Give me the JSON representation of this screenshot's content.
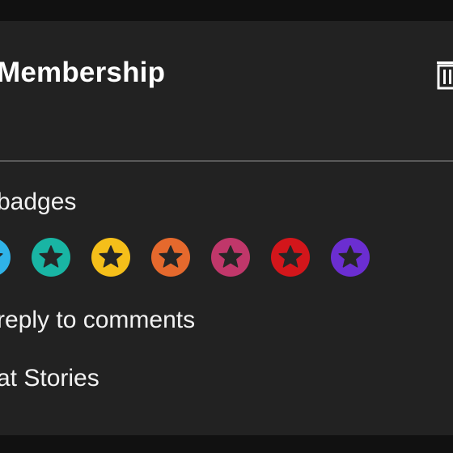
{
  "header": {
    "title": "Membership"
  },
  "perks": [
    {
      "label": "badges"
    },
    {
      "label": "reply to comments"
    },
    {
      "label": "at Stories"
    }
  ],
  "badges": [
    {
      "name": "badge-sky",
      "color": "#2fb3e8"
    },
    {
      "name": "badge-teal",
      "color": "#19b5a4"
    },
    {
      "name": "badge-yellow",
      "color": "#f5bf1a"
    },
    {
      "name": "badge-orange",
      "color": "#e5692d"
    },
    {
      "name": "badge-pink",
      "color": "#c0376a"
    },
    {
      "name": "badge-red",
      "color": "#d3161b"
    },
    {
      "name": "badge-purple",
      "color": "#6b2ed1"
    }
  ],
  "colors": {
    "panel": "#222222",
    "background": "#111111",
    "star": "#262626"
  }
}
